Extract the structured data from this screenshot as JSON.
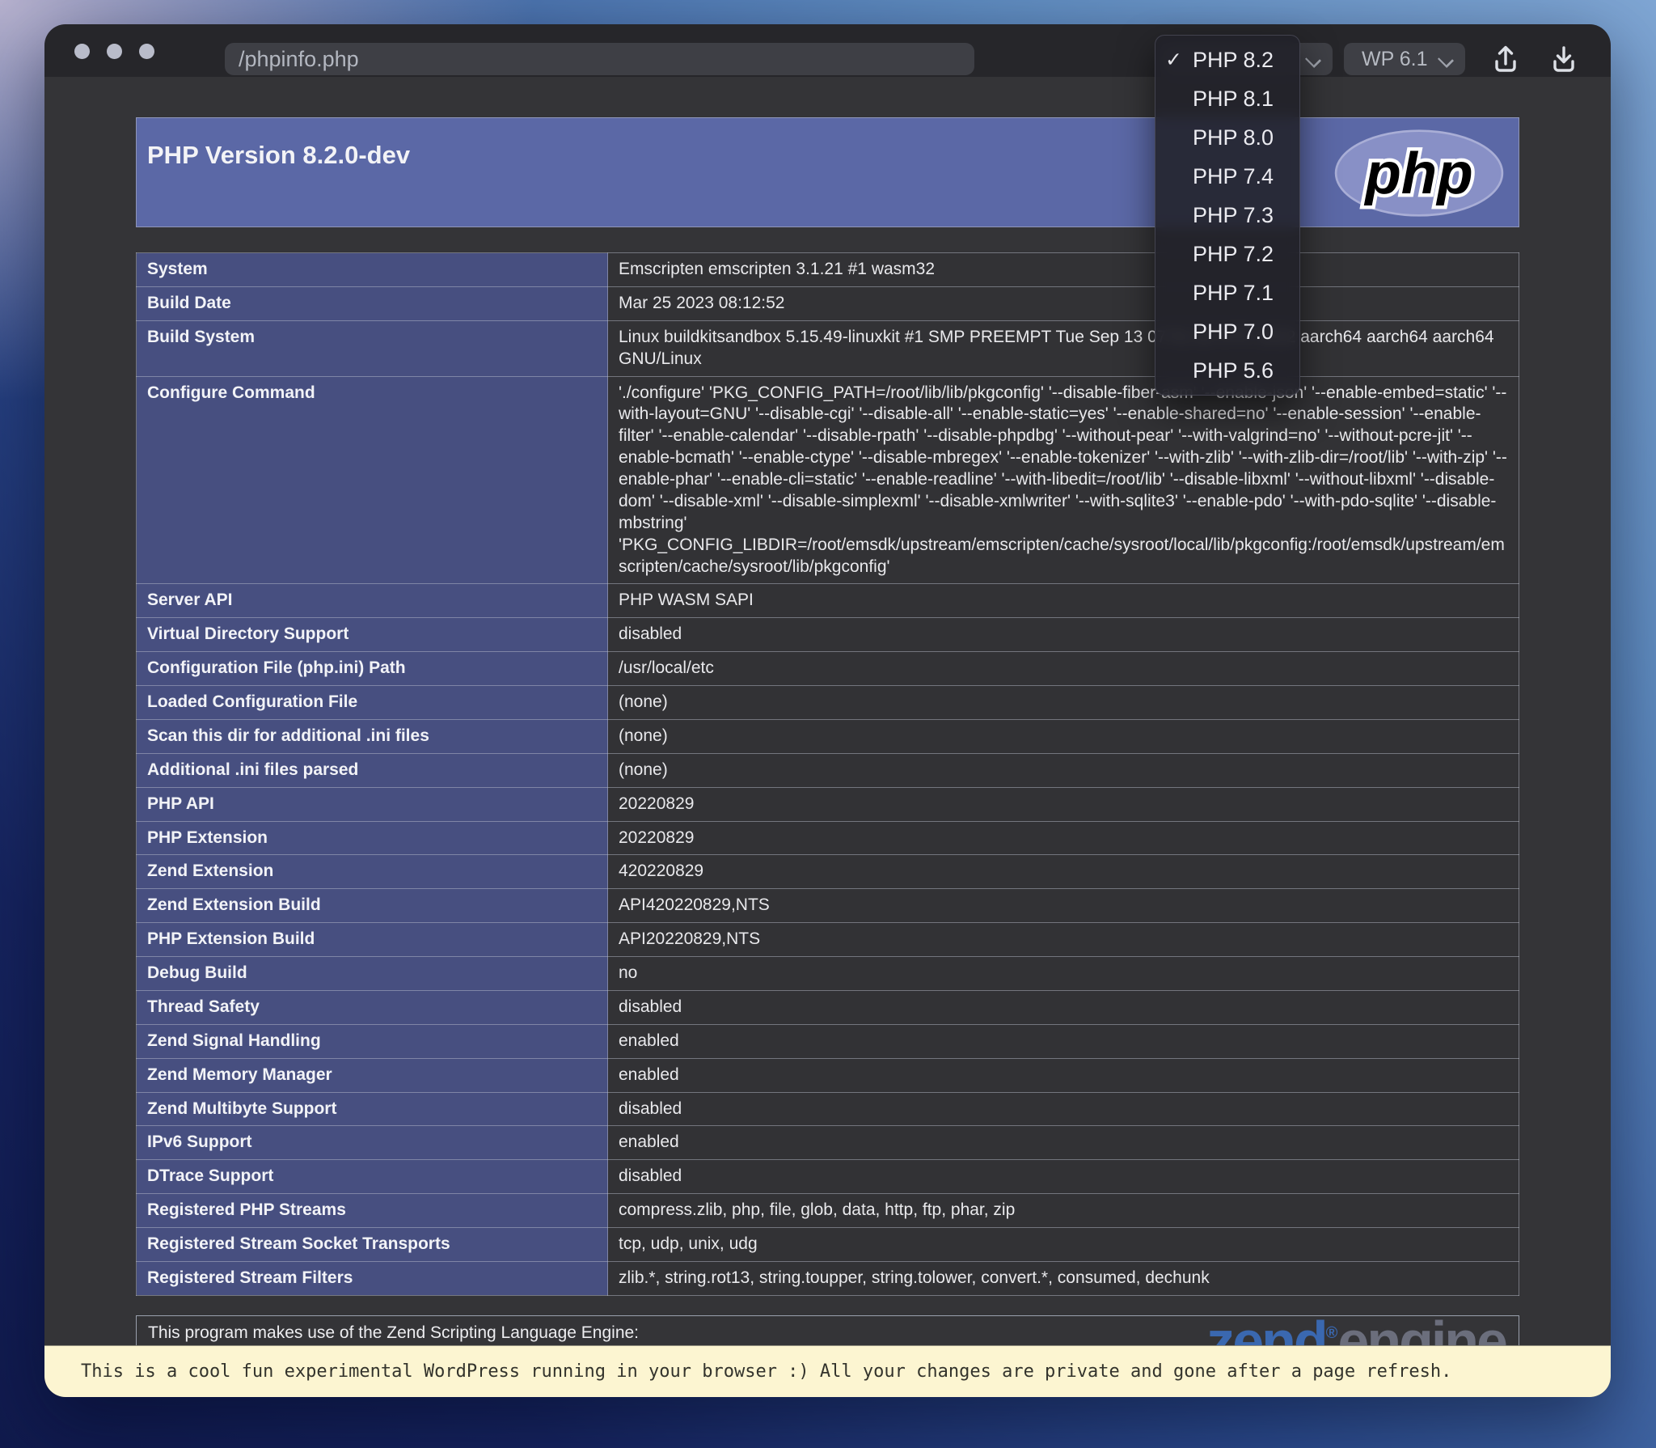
{
  "colors": {
    "header_blue": "#5b68a6",
    "label_cell_indigo": "#474f80",
    "banner_yellow": "#fcf5d1",
    "php_logo_purple": "#8890c6",
    "zend_logo_blue": "#3a68b0"
  },
  "toolbar": {
    "url": "/phpinfo.php",
    "php_selector": {
      "selected": "PHP 8.2"
    },
    "wp_selector": {
      "selected": "WP 6.1"
    }
  },
  "php_menu": {
    "items": [
      {
        "label": "PHP 8.2",
        "check": "✓"
      },
      {
        "label": "PHP 8.1",
        "check": ""
      },
      {
        "label": "PHP 8.0",
        "check": ""
      },
      {
        "label": "PHP 7.4",
        "check": ""
      },
      {
        "label": "PHP 7.3",
        "check": ""
      },
      {
        "label": "PHP 7.2",
        "check": ""
      },
      {
        "label": "PHP 7.1",
        "check": ""
      },
      {
        "label": "PHP 7.0",
        "check": ""
      },
      {
        "label": "PHP 5.6",
        "check": ""
      }
    ]
  },
  "page": {
    "header": {
      "title": "PHP Version 8.2.0-dev",
      "logo_text": "php"
    },
    "info_rows": [
      {
        "label": "System",
        "value": "Emscripten emscripten 3.1.21 #1 wasm32"
      },
      {
        "label": "Build Date",
        "value": "Mar 25 2023 08:12:52"
      },
      {
        "label": "Build System",
        "value": "Linux buildkitsandbox 5.15.49-linuxkit #1 SMP PREEMPT Tue Sep 13 07:51:32 UTC 2022 aarch64 aarch64 aarch64 GNU/Linux"
      },
      {
        "label": "Configure Command",
        "value": "'./configure' 'PKG_CONFIG_PATH=/root/lib/lib/pkgconfig' '--disable-fiber-asm' '--enable-json' '--enable-embed=static' '--with-layout=GNU' '--disable-cgi' '--disable-all' '--enable-static=yes' '--enable-shared=no' '--enable-session' '--enable-filter' '--enable-calendar' '--disable-rpath' '--disable-phpdbg' '--without-pear' '--with-valgrind=no' '--without-pcre-jit' '--enable-bcmath' '--enable-ctype' '--disable-mbregex' '--enable-tokenizer' '--with-zlib' '--with-zlib-dir=/root/lib' '--with-zip' '--enable-phar' '--enable-cli=static' '--enable-readline' '--with-libedit=/root/lib' '--disable-libxml' '--without-libxml' '--disable-dom' '--disable-xml' '--disable-simplexml' '--disable-xmlwriter' '--with-sqlite3' '--enable-pdo' '--with-pdo-sqlite' '--disable-mbstring' 'PKG_CONFIG_LIBDIR=/root/emsdk/upstream/emscripten/cache/sysroot/local/lib/pkgconfig:/root/emsdk/upstream/emscripten/cache/sysroot/lib/pkgconfig'"
      },
      {
        "label": "Server API",
        "value": "PHP WASM SAPI"
      },
      {
        "label": "Virtual Directory Support",
        "value": "disabled"
      },
      {
        "label": "Configuration File (php.ini) Path",
        "value": "/usr/local/etc"
      },
      {
        "label": "Loaded Configuration File",
        "value": "(none)"
      },
      {
        "label": "Scan this dir for additional .ini files",
        "value": "(none)"
      },
      {
        "label": "Additional .ini files parsed",
        "value": "(none)"
      },
      {
        "label": "PHP API",
        "value": "20220829"
      },
      {
        "label": "PHP Extension",
        "value": "20220829"
      },
      {
        "label": "Zend Extension",
        "value": "420220829"
      },
      {
        "label": "Zend Extension Build",
        "value": "API420220829,NTS"
      },
      {
        "label": "PHP Extension Build",
        "value": "API20220829,NTS"
      },
      {
        "label": "Debug Build",
        "value": "no"
      },
      {
        "label": "Thread Safety",
        "value": "disabled"
      },
      {
        "label": "Zend Signal Handling",
        "value": "enabled"
      },
      {
        "label": "Zend Memory Manager",
        "value": "enabled"
      },
      {
        "label": "Zend Multibyte Support",
        "value": "disabled"
      },
      {
        "label": "IPv6 Support",
        "value": "enabled"
      },
      {
        "label": "DTrace Support",
        "value": "disabled"
      },
      {
        "label": "Registered PHP Streams",
        "value": "compress.zlib, php, file, glob, data, http, ftp, phar, zip"
      },
      {
        "label": "Registered Stream Socket Transports",
        "value": "tcp, udp, unix, udg"
      },
      {
        "label": "Registered Stream Filters",
        "value": "zlib.*, string.rot13, string.toupper, string.tolower, convert.*, consumed, dechunk"
      }
    ],
    "zend_section": {
      "text": "This program makes use of the Zend Scripting Language Engine:",
      "logo_zend": "zend",
      "logo_reg": "®",
      "logo_engine": "engine"
    }
  },
  "banner": {
    "text": "This is a cool fun experimental WordPress running in your browser :) All your changes are private and gone after a page refresh."
  }
}
